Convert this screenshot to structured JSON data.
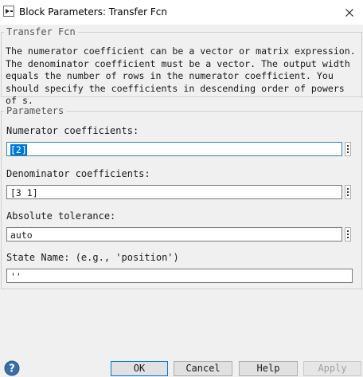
{
  "window": {
    "title": "Block Parameters: Transfer Fcn",
    "app_icon": "simulink-block-icon",
    "close_icon": "close-icon"
  },
  "block_group": {
    "legend": "Transfer Fcn",
    "description": "The numerator coefficient can be a vector or matrix expression. The denominator coefficient must be a vector. The output width equals the number of rows in the numerator coefficient. You should specify the coefficients in descending order of powers of s."
  },
  "parameters": {
    "legend": "Parameters",
    "numerator": {
      "label": "Numerator coefficients:",
      "value": "[2]"
    },
    "denominator": {
      "label": "Denominator coefficients:",
      "value": "[3 1]"
    },
    "abs_tol": {
      "label": "Absolute tolerance:",
      "value": "auto"
    },
    "state_name": {
      "label": "State Name: (e.g., 'position')",
      "value": "''"
    }
  },
  "buttons": {
    "ok": "OK",
    "cancel": "Cancel",
    "help": "Help",
    "apply": "Apply"
  },
  "colors": {
    "focus_border": "#3c7fb1",
    "selection": "#0078d7",
    "help_icon": "#3a6ea8"
  }
}
